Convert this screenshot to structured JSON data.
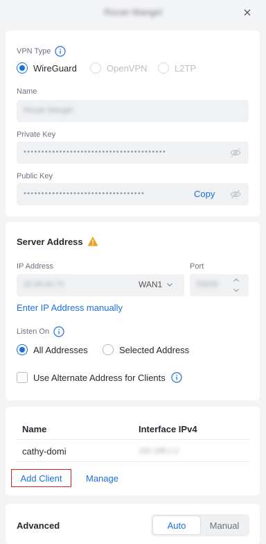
{
  "header": {
    "title": "Rocan Mangel"
  },
  "vpn": {
    "type_label": "VPN Type",
    "options": [
      {
        "label": "WireGuard",
        "selected": true,
        "enabled": true
      },
      {
        "label": "OpenVPN",
        "selected": false,
        "enabled": false
      },
      {
        "label": "L2TP",
        "selected": false,
        "enabled": false
      }
    ],
    "name_label": "Name",
    "name_value": "Rocan Mangel",
    "private_key_label": "Private Key",
    "private_key_mask": "••••••••••••••••••••••••••••••••••••••••",
    "public_key_label": "Public Key",
    "public_key_mask": "••••••••••••••••••••••••••••••••••",
    "copy_label": "Copy"
  },
  "server": {
    "title": "Server Address",
    "ip_label": "IP Address",
    "ip_value": "32.64.64.73",
    "wan_value": "WAN1",
    "port_label": "Port",
    "port_value": "53626",
    "manual_link": "Enter IP Address manually",
    "listen_label": "Listen On",
    "listen_options": [
      {
        "label": "All Addresses",
        "selected": true
      },
      {
        "label": "Selected Address",
        "selected": false
      }
    ],
    "alt_address_label": "Use Alternate Address for Clients"
  },
  "clients": {
    "columns": [
      "Name",
      "Interface IPv4"
    ],
    "rows": [
      {
        "name": "cathy-domi",
        "ipv4": "192.168.2.2"
      }
    ],
    "add_label": "Add Client",
    "manage_label": "Manage"
  },
  "advanced": {
    "title": "Advanced",
    "modes": [
      "Auto",
      "Manual"
    ],
    "selected_mode": "Auto"
  },
  "colors": {
    "accent": "#1b6fe0",
    "warning": "#f0a020",
    "highlight_box": "#d42020"
  }
}
